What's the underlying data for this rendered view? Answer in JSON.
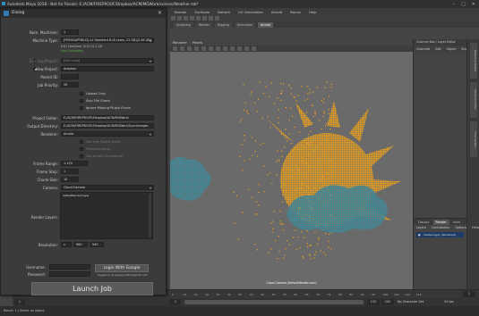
{
  "maya": {
    "title": "Autodesk Maya 2018 - Not for Resale: E:/ACM/FIREPROOF/Dropbox/ACM/MGWork/scenes/Weather.mb*",
    "menus": [
      "Render",
      "Surfaces",
      "Deform",
      "UV Generation",
      "Arnold",
      "Bonus",
      "Help"
    ],
    "shelf_tabs": [
      "Sculpting",
      "Render",
      "Rigging",
      "Animation",
      "Arnold"
    ],
    "shelf_active": 4,
    "panel_menu": [
      "Renderer",
      "Panels"
    ],
    "viewport_camera_label": "Cloud Camera (defaultRender.cam)",
    "channel_box": {
      "header": "Channel Box / Layer Editor",
      "menus": [
        "Channels",
        "Edit",
        "Object",
        "Show"
      ]
    },
    "layer_tabs": [
      "Display",
      "Render",
      "Anim"
    ],
    "layer_tab_active": 1,
    "layer_menus": [
      "Layers",
      "Contribution",
      "Options",
      "Help"
    ],
    "layer_row": "masterLayer (Rendered)",
    "side_tabs": [
      "Modeling Toolkit",
      "Attribute Editor",
      "Channel Box"
    ],
    "cmdline": "Result: 1 | Select an object",
    "timeline_ticks": [
      "5",
      "10",
      "15",
      "20",
      "25",
      "30",
      "35",
      "40",
      "45",
      "50",
      "55",
      "60",
      "65",
      "70",
      "75",
      "80",
      "85",
      "90",
      "95",
      "100",
      "105",
      "110",
      "115"
    ],
    "current_frame": "1",
    "range_start": "1",
    "range_end": "120",
    "range_end2": "200",
    "layer_set": "No Character Set",
    "fps": "24 fps"
  },
  "dialog": {
    "title": "Dialog",
    "num_machines_label": "Num. Machines:",
    "num_machines": "1",
    "machine_type_label": "Machine Type:",
    "machine_type": "[PRESHAPTBILD] x1 Standard 8 (8 cores, 22 GB)[3.36 GB]",
    "machine_sub1": "8.8 / Core/Hour (0.9) 1% 1.28",
    "machine_sub2": "Cost Calculation",
    "existing_project_label": "Existing Project:",
    "existing_project": "[Not Used]",
    "new_project_label": "New Project:",
    "new_project": "dropbox",
    "parent_id_label": "Parent ID:",
    "parent_id": "",
    "job_priority_label": "Job Priority:",
    "job_priority": "50",
    "opt_upload_only": "Upload Only",
    "opt_skip_file_check": "Skip File Check",
    "opt_ignore_missing": "Ignore Missing Plugin Errors",
    "project_folder_label": "Project Folder:",
    "project_folder": "E:/ACM/FIREPROOF/Dropbox/ACM/MGWork/",
    "output_dir_label": "Output Directory:",
    "output_dir": "E:/ACM/FIREPROOF/Dropbox/ACM/MGWork/Sync/images",
    "renderer_label": "Renderer:",
    "renderer": "Arnold",
    "opt_use_image_utils": "Use Ireg Toolkit Suffix",
    "opt_skip_postproc": "Postprocessing",
    "opt_upload_standalone": "Use Arnold Standalone",
    "frame_range_label": "Frame Range:",
    "frame_range": "1-120",
    "frame_step_label": "Frame Step:",
    "frame_step": "1",
    "chunk_size_label": "Chunk Size:",
    "chunk_size": "10",
    "camera_label": "Camera:",
    "camera": "Cloud:Camera",
    "render_layers_label": "Render Layers:",
    "render_layers_item": "defaultRenderLayer",
    "resolution_label": "Resolution:",
    "res_w": "960",
    "res_h": "540",
    "username_label": "Username:",
    "password_label": "Password:",
    "login_google": "Login With Google",
    "logged_in": "Logged in as gregory.diller@gmail.com",
    "launch_job": "Launch Job"
  },
  "colors": {
    "sun": "#f0a21a",
    "cloud": "#3a8ea0",
    "viewport": "#6a6a6a",
    "dialog_bg": "#3b3b3b"
  }
}
